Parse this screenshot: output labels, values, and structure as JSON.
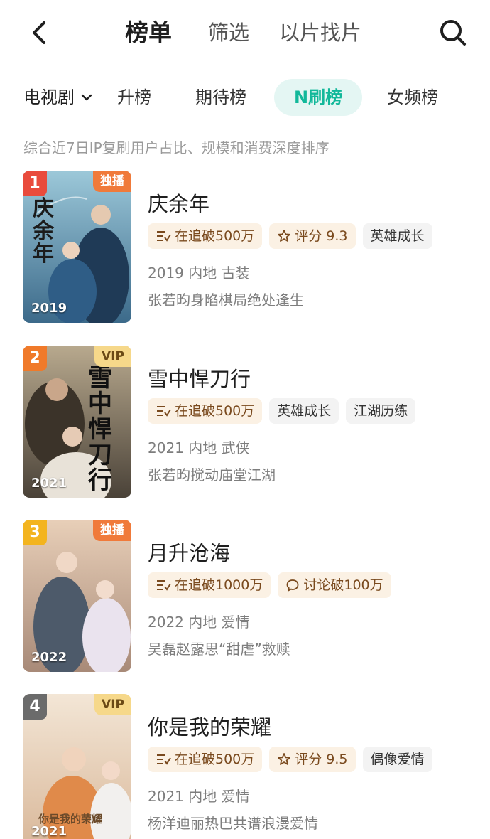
{
  "header": {
    "tabs": [
      {
        "label": "榜单",
        "active": true
      },
      {
        "label": "筛选",
        "active": false
      },
      {
        "label": "以片找片",
        "active": false
      }
    ],
    "back_icon": "chevron-left-icon",
    "search_icon": "search-icon"
  },
  "filter": {
    "category": "电视剧",
    "chips": [
      {
        "label": "升榜",
        "active": false
      },
      {
        "label": "期待榜",
        "active": false
      },
      {
        "label": "N刷榜",
        "active": true
      },
      {
        "label": "女频榜",
        "active": false
      }
    ]
  },
  "subtitle": "综合近7日IP复刷用户占比、规模和消费深度排序",
  "colors": {
    "accent": "#12b89a",
    "chip_bg": "#e4f6f3",
    "rank1": "#e94b3c",
    "rank2": "#f07a2a",
    "rank3": "#f3b41f",
    "rank4": "#6b6b6b",
    "excl": "#f07a3a",
    "vip": "#f6d88a"
  },
  "items": [
    {
      "rank": "1",
      "badge": "独播",
      "poster_year": "2019",
      "poster_text": "庆余年",
      "title": "庆余年",
      "tags": [
        {
          "icon": "list-trend-icon",
          "label": "在追破500万"
        },
        {
          "icon": "star-icon",
          "label": "评分 9.3"
        },
        {
          "icon": "",
          "label": "英雄成长"
        }
      ],
      "meta": "2019 内地 古装",
      "desc": "张若昀身陷棋局绝处逢生"
    },
    {
      "rank": "2",
      "badge": "VIP",
      "poster_year": "2021",
      "poster_text": "雪中悍刀行",
      "title": "雪中悍刀行",
      "tags": [
        {
          "icon": "list-trend-icon",
          "label": "在追破500万"
        },
        {
          "icon": "",
          "label": "英雄成长"
        },
        {
          "icon": "",
          "label": "江湖历练"
        }
      ],
      "meta": "2021 内地 武侠",
      "desc": "张若昀搅动庙堂江湖"
    },
    {
      "rank": "3",
      "badge": "独播",
      "poster_year": "2022",
      "poster_text": "",
      "title": "月升沧海",
      "tags": [
        {
          "icon": "list-trend-icon",
          "label": "在追破1000万"
        },
        {
          "icon": "chat-bubble-icon",
          "label": "讨论破100万"
        }
      ],
      "meta": "2022 内地 爱情",
      "desc": "吴磊赵露思“甜虐”救赎"
    },
    {
      "rank": "4",
      "badge": "VIP",
      "poster_year": "2021",
      "poster_text": "你是我的荣耀",
      "title": "你是我的荣耀",
      "tags": [
        {
          "icon": "list-trend-icon",
          "label": "在追破500万"
        },
        {
          "icon": "star-icon",
          "label": "评分 9.5"
        },
        {
          "icon": "",
          "label": "偶像爱情"
        }
      ],
      "meta": "2021 内地 爱情",
      "desc": "杨洋迪丽热巴共谱浪漫爱情"
    }
  ]
}
